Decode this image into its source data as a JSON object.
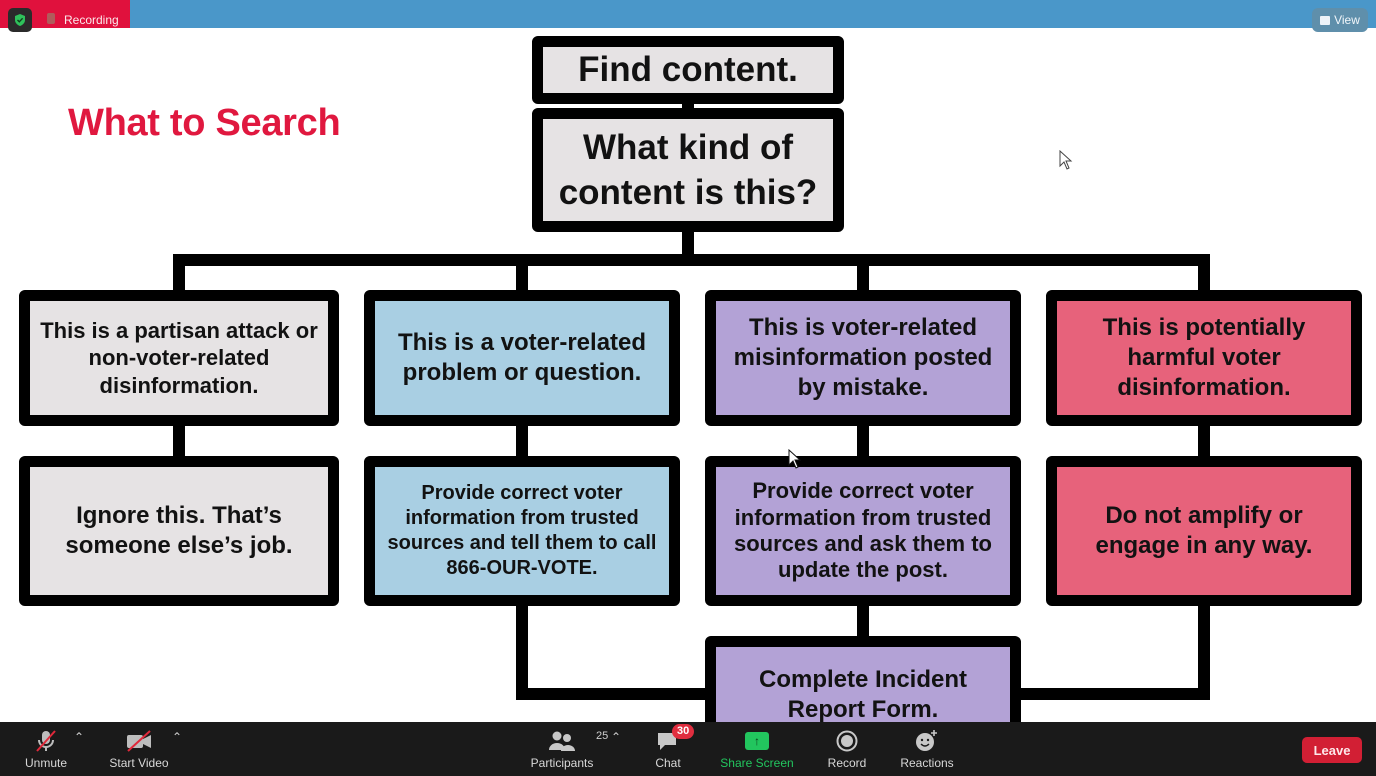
{
  "window": {
    "recording_label": "Recording",
    "view_label": "View",
    "colors": {
      "topbar": "#4a97c9",
      "recording": "#e0113d",
      "title": "#e0183f",
      "gray_node": "#e6e3e4",
      "blue_node": "#a9cfe3",
      "purple_node": "#b3a2d6",
      "pink_node": "#e7627b",
      "share_green": "#22c55e",
      "leave_red": "#d21f34"
    }
  },
  "slide": {
    "title": "What to Search",
    "flowchart": {
      "start": "Find content.",
      "question": "What kind of content is this?",
      "categories": [
        {
          "label": "This is a partisan attack or non-voter-related disinformation.",
          "action": "Ignore this. That’s someone else’s job.",
          "color": "gray"
        },
        {
          "label": "This is a voter-related problem or question.",
          "action": "Provide correct voter information from trusted sources and tell them to call 866-OUR-VOTE.",
          "color": "blue"
        },
        {
          "label": "This is voter-related misinformation posted by mistake.",
          "action": "Provide correct voter information from trusted sources and ask them to update the post.",
          "color": "purple"
        },
        {
          "label": "This is potentially harmful voter disinformation.",
          "action": "Do not amplify or engage in any way.",
          "color": "pink"
        }
      ],
      "final": "Complete Incident Report Form."
    }
  },
  "toolbar": {
    "unmute": "Unmute",
    "start_video": "Start Video",
    "participants": "Participants",
    "participants_count": "25",
    "chat": "Chat",
    "chat_badge": "30",
    "share_screen": "Share Screen",
    "record": "Record",
    "reactions": "Reactions",
    "leave": "Leave"
  }
}
